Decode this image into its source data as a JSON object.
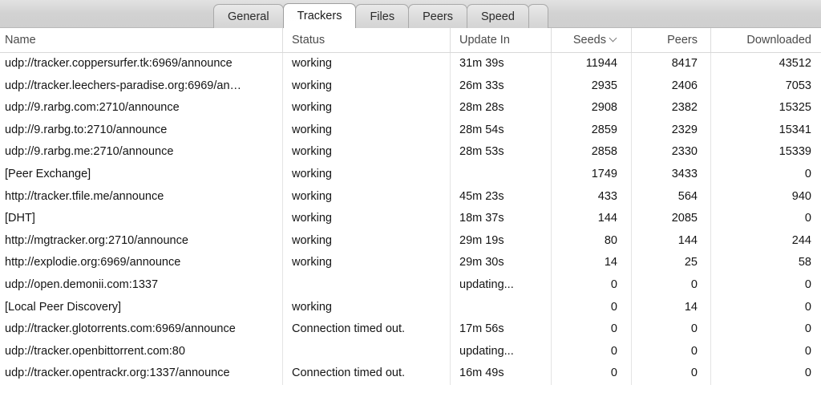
{
  "window": {
    "app_context": "torrent-details"
  },
  "tabs": {
    "items": [
      {
        "label": "General",
        "active": false
      },
      {
        "label": "Trackers",
        "active": true
      },
      {
        "label": "Files",
        "active": false
      },
      {
        "label": "Peers",
        "active": false
      },
      {
        "label": "Speed",
        "active": false
      }
    ]
  },
  "table": {
    "columns": [
      {
        "key": "name",
        "label": "Name",
        "align": "left",
        "sorted": false
      },
      {
        "key": "status",
        "label": "Status",
        "align": "left",
        "sorted": false
      },
      {
        "key": "update_in",
        "label": "Update In",
        "align": "left",
        "sorted": false
      },
      {
        "key": "seeds",
        "label": "Seeds",
        "align": "right",
        "sorted": true,
        "sort_icon": "chevron-down-icon"
      },
      {
        "key": "peers",
        "label": "Peers",
        "align": "right",
        "sorted": false
      },
      {
        "key": "downloaded",
        "label": "Downloaded",
        "align": "right",
        "sorted": false
      }
    ],
    "rows": [
      {
        "name": "udp://tracker.coppersurfer.tk:6969/announce",
        "status": "working",
        "update_in": "31m 39s",
        "seeds": "11944",
        "peers": "8417",
        "downloaded": "43512"
      },
      {
        "name": "udp://tracker.leechers-paradise.org:6969/an…",
        "status": "working",
        "update_in": "26m 33s",
        "seeds": "2935",
        "peers": "2406",
        "downloaded": "7053"
      },
      {
        "name": "udp://9.rarbg.com:2710/announce",
        "status": "working",
        "update_in": "28m 28s",
        "seeds": "2908",
        "peers": "2382",
        "downloaded": "15325"
      },
      {
        "name": "udp://9.rarbg.to:2710/announce",
        "status": "working",
        "update_in": "28m 54s",
        "seeds": "2859",
        "peers": "2329",
        "downloaded": "15341"
      },
      {
        "name": "udp://9.rarbg.me:2710/announce",
        "status": "working",
        "update_in": "28m 53s",
        "seeds": "2858",
        "peers": "2330",
        "downloaded": "15339"
      },
      {
        "name": "[Peer Exchange]",
        "status": "working",
        "update_in": "",
        "seeds": "1749",
        "peers": "3433",
        "downloaded": "0"
      },
      {
        "name": "http://tracker.tfile.me/announce",
        "status": "working",
        "update_in": "45m 23s",
        "seeds": "433",
        "peers": "564",
        "downloaded": "940"
      },
      {
        "name": "[DHT]",
        "status": "working",
        "update_in": "18m 37s",
        "seeds": "144",
        "peers": "2085",
        "downloaded": "0"
      },
      {
        "name": "http://mgtracker.org:2710/announce",
        "status": "working",
        "update_in": "29m 19s",
        "seeds": "80",
        "peers": "144",
        "downloaded": "244"
      },
      {
        "name": "http://explodie.org:6969/announce",
        "status": "working",
        "update_in": "29m 30s",
        "seeds": "14",
        "peers": "25",
        "downloaded": "58"
      },
      {
        "name": "udp://open.demonii.com:1337",
        "status": "",
        "update_in": "updating...",
        "seeds": "0",
        "peers": "0",
        "downloaded": "0"
      },
      {
        "name": "[Local Peer Discovery]",
        "status": "working",
        "update_in": "",
        "seeds": "0",
        "peers": "14",
        "downloaded": "0"
      },
      {
        "name": "udp://tracker.glotorrents.com:6969/announce",
        "status": "Connection timed out.",
        "update_in": "17m 56s",
        "seeds": "0",
        "peers": "0",
        "downloaded": "0"
      },
      {
        "name": "udp://tracker.openbittorrent.com:80",
        "status": "",
        "update_in": "updating...",
        "seeds": "0",
        "peers": "0",
        "downloaded": "0"
      },
      {
        "name": "udp://tracker.opentrackr.org:1337/announce",
        "status": "Connection timed out.",
        "update_in": "16m 49s",
        "seeds": "0",
        "peers": "0",
        "downloaded": "0"
      }
    ]
  },
  "colors": {
    "toolbar_top": "#e2e2e2",
    "toolbar_bottom": "#cfcfcf",
    "active_tab_bg": "#ffffff",
    "text": "#141414",
    "header_text": "#4a4a4a",
    "divider": "#e4e4e4"
  }
}
